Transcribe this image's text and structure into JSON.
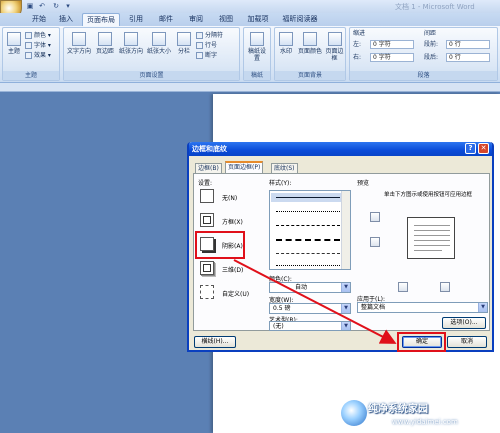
{
  "titlebar": {
    "title": "文档 1 - Microsoft Word",
    "qa_icons": [
      "save-icon",
      "undo-icon",
      "redo-icon"
    ]
  },
  "tabs": [
    {
      "label": "开始"
    },
    {
      "label": "插入"
    },
    {
      "label": "页面布局",
      "active": true
    },
    {
      "label": "引用"
    },
    {
      "label": "邮件"
    },
    {
      "label": "审阅"
    },
    {
      "label": "视图"
    },
    {
      "label": "加载项"
    },
    {
      "label": "福昕阅读器"
    }
  ],
  "ribbon": {
    "theme": {
      "main": "主题",
      "colors": "颜色",
      "fonts": "字体",
      "effects": "效果",
      "title": "主题"
    },
    "page_setup": {
      "margins": "文字方向",
      "margin2": "页边距",
      "orientation": "纸张方向",
      "size": "纸张大小",
      "columns": "分栏",
      "breaks": "分隔符",
      "line_numbers": "行号",
      "hyphen": "断字",
      "title": "页面设置"
    },
    "paper": {
      "draft": "稿纸设置",
      "title": "稿纸"
    },
    "background": {
      "watermark": "水印",
      "page_color": "页面颜色",
      "borders": "页面边框",
      "title": "页面背景"
    },
    "paragraph": {
      "indent": "缩进",
      "left": "左:",
      "right": "右:",
      "left_val": "0 字符",
      "right_val": "0 字符",
      "spacing": "间距",
      "before": "段前:",
      "after": "段后:",
      "before_val": "0 行",
      "after_val": "0 行",
      "title": "段落"
    }
  },
  "dialog": {
    "title": "边框和底纹",
    "tabs": [
      {
        "label": "边框(B)"
      },
      {
        "label": "页面边框(P)",
        "active": true
      },
      {
        "label": "底纹(S)"
      }
    ],
    "setting_label": "设置:",
    "settings": [
      {
        "label": "无(N)"
      },
      {
        "label": "方框(X)"
      },
      {
        "label": "阴影(A)",
        "selected": true
      },
      {
        "label": "三维(D)"
      },
      {
        "label": "自定义(U)"
      }
    ],
    "style_label": "样式(Y):",
    "color_label": "颜色(C):",
    "color_value": "自动",
    "width_label": "宽度(W):",
    "width_value": "0.5 磅",
    "art_label": "艺术型(R):",
    "art_value": "(无)",
    "preview_label": "预览",
    "preview_hint": "单击下方图示或使用按钮可应用边框",
    "apply_label": "应用于(L):",
    "apply_value": "整篇文档",
    "options_btn": "选项(O)...",
    "hline_btn": "横线(H)...",
    "ok_btn": "确定",
    "cancel_btn": "取消"
  },
  "watermark": {
    "name": "纯净系统家园",
    "url": "www.yidaimei.com"
  }
}
